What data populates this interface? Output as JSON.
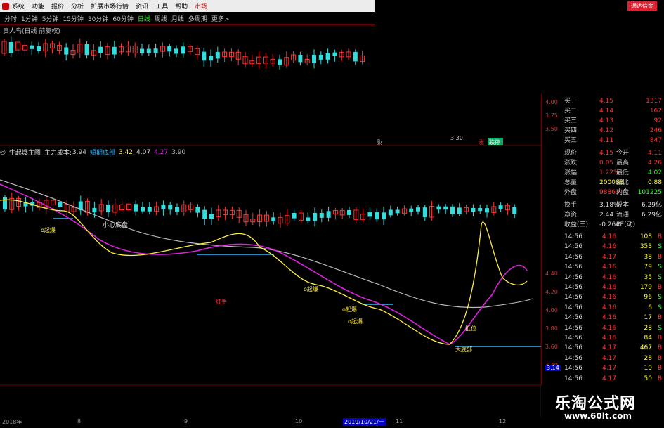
{
  "menu": {
    "items": [
      "系统",
      "功能",
      "报价",
      "分析",
      "扩展市场行情",
      "资讯",
      "工具",
      "帮助",
      "市场"
    ],
    "quick_button": "通达信金"
  },
  "periods": [
    "分时",
    "1分钟",
    "5分钟",
    "15分钟",
    "30分钟",
    "60分钟",
    "日线",
    "周线",
    "月线",
    "多周期",
    "更多>"
  ],
  "active_period": "日线",
  "stock_title": "贵人鸟(日线 前复权)",
  "main_indicator": {
    "name": "牛起爆主图",
    "cost_label": "主力成本:",
    "cost_value": "3.94",
    "short_label": "短期底部",
    "v1": "3.42",
    "v2": "4.07",
    "v3": "4.27",
    "v4": "3.90"
  },
  "annotations": {
    "small_bottom": "小心底盘",
    "start1": "o起爆",
    "start2": "o起爆",
    "start3": "o起爆",
    "start4": "o起爆",
    "buy": "抵位",
    "big_bottom": "大底部",
    "red_mark": "红手",
    "price_low": "3.30",
    "signal_cai": "财",
    "signal_zhang": "涨",
    "signal_die": "跌停"
  },
  "upper_scale": [
    "4.00",
    "3.75",
    "3.50"
  ],
  "lower_scale": [
    "4.40",
    "4.20",
    "4.00",
    "3.80",
    "3.60",
    "3.40",
    "3.14"
  ],
  "quote": {
    "bids": [
      {
        "label": "买一",
        "price": "4.15",
        "vol": "1317"
      },
      {
        "label": "买二",
        "price": "4.14",
        "vol": "162"
      },
      {
        "label": "买三",
        "price": "4.13",
        "vol": "92"
      },
      {
        "label": "买四",
        "price": "4.12",
        "vol": "246"
      },
      {
        "label": "买五",
        "price": "4.11",
        "vol": "847"
      }
    ],
    "stats": [
      {
        "l1": "现价",
        "v1": "4.15",
        "l2": "今开",
        "v2": "4.11"
      },
      {
        "l1": "涨跌",
        "v1": "0.05",
        "l2": "最高",
        "v2": "4.26"
      },
      {
        "l1": "涨幅",
        "v1": "1.22%",
        "l2": "最低",
        "v2": "4.02"
      },
      {
        "l1": "总量",
        "v1": "200088",
        "l2": "量比",
        "v2": "0.88"
      },
      {
        "l1": "外盘",
        "v1": "98863",
        "l2": "内盘",
        "v2": "101225"
      },
      {
        "l1": "换手",
        "v1": "3.18%",
        "l2": "股本",
        "v2": "6.29亿"
      },
      {
        "l1": "净资",
        "v1": "2.44",
        "l2": "流通",
        "v2": "6.29亿"
      },
      {
        "l1": "收益(三)",
        "v1": "-0.264",
        "l2": "PE(动)",
        "v2": ""
      }
    ],
    "ticks": [
      {
        "t": "14:56",
        "p": "4.16",
        "v": "108",
        "s": "B"
      },
      {
        "t": "14:56",
        "p": "4.16",
        "v": "353",
        "s": "S"
      },
      {
        "t": "14:56",
        "p": "4.17",
        "v": "38",
        "s": "B"
      },
      {
        "t": "14:56",
        "p": "4.16",
        "v": "79",
        "s": "S"
      },
      {
        "t": "14:56",
        "p": "4.16",
        "v": "35",
        "s": "S"
      },
      {
        "t": "14:56",
        "p": "4.16",
        "v": "179",
        "s": "B"
      },
      {
        "t": "14:56",
        "p": "4.16",
        "v": "96",
        "s": "S"
      },
      {
        "t": "14:56",
        "p": "4.16",
        "v": "6",
        "s": "S"
      },
      {
        "t": "14:56",
        "p": "4.16",
        "v": "17",
        "s": "B"
      },
      {
        "t": "14:56",
        "p": "4.16",
        "v": "28",
        "s": "S"
      },
      {
        "t": "14:56",
        "p": "4.16",
        "v": "84",
        "s": "B"
      },
      {
        "t": "14:56",
        "p": "4.17",
        "v": "467",
        "s": "B"
      },
      {
        "t": "14:56",
        "p": "4.17",
        "v": "28",
        "s": "B"
      },
      {
        "t": "14:56",
        "p": "4.17",
        "v": "10",
        "s": "B"
      },
      {
        "t": "14:56",
        "p": "4.17",
        "v": "50",
        "s": "B"
      }
    ]
  },
  "bottom_axis": [
    "2018年",
    "8",
    "9",
    "10",
    "2019/10/21/一",
    "11",
    "12"
  ],
  "watermark": {
    "title": "乐淘公式网",
    "url": "www.60lt.com"
  },
  "colors": {
    "up": "#ff3333",
    "down": "#33dddd",
    "ma_yellow": "#ffee44",
    "ma_magenta": "#dd22dd",
    "ma_gray": "#bbbbbb",
    "cost_line": "#33bbff"
  }
}
